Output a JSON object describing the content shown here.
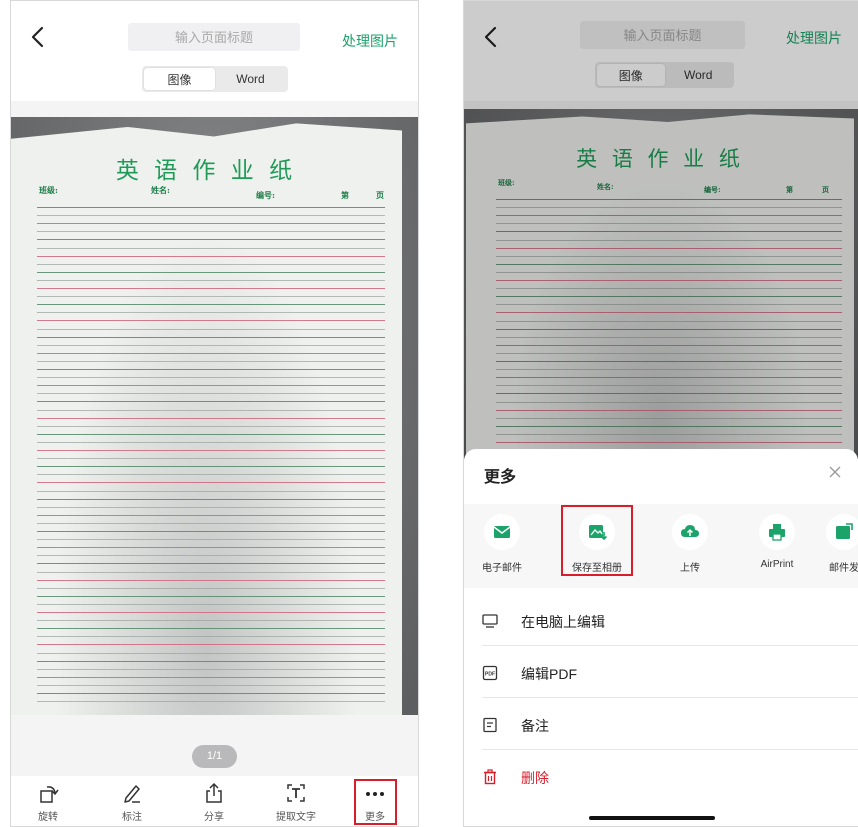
{
  "colors": {
    "accent": "#1ba36a",
    "danger": "#d61f2b",
    "paper_green": "#1f9b57"
  },
  "left_screen": {
    "header": {
      "placeholder": "输入页面标题",
      "process_label": "处理图片",
      "tabs": [
        "图像",
        "Word"
      ]
    },
    "document": {
      "title": "英 语 作 业 纸",
      "fields": {
        "class": "班级:",
        "name": "姓名:",
        "number": "编号:",
        "page_prefix": "第",
        "page_suffix": "页"
      }
    },
    "page_indicator": "1/1",
    "toolbar": [
      {
        "label": "旋转",
        "icon": "rotate-icon"
      },
      {
        "label": "标注",
        "icon": "pen-icon"
      },
      {
        "label": "分享",
        "icon": "share-icon"
      },
      {
        "label": "提取文字",
        "icon": "text-extract-icon"
      },
      {
        "label": "更多",
        "icon": "more-icon"
      }
    ]
  },
  "right_screen": {
    "header": {
      "placeholder": "输入页面标题",
      "process_label": "处理图片",
      "tabs": [
        "图像",
        "Word"
      ]
    },
    "document": {
      "title": "英 语 作 业 纸",
      "fields": {
        "class": "班级:",
        "name": "姓名:",
        "number": "编号:",
        "page_prefix": "第",
        "page_suffix": "页"
      }
    },
    "sheet": {
      "title": "更多",
      "options": [
        {
          "label": "电子邮件",
          "icon": "mail-icon"
        },
        {
          "label": "保存至相册",
          "icon": "save-photo-icon"
        },
        {
          "label": "上传",
          "icon": "cloud-upload-icon"
        },
        {
          "label": "AirPrint",
          "icon": "printer-icon"
        },
        {
          "label": "邮件发",
          "icon": "mail-send-icon"
        }
      ],
      "list": [
        {
          "label": "在电脑上编辑",
          "icon": "monitor-icon"
        },
        {
          "label": "编辑PDF",
          "icon": "pdf-icon"
        },
        {
          "label": "备注",
          "icon": "note-icon"
        },
        {
          "label": "删除",
          "icon": "trash-icon"
        }
      ]
    }
  }
}
